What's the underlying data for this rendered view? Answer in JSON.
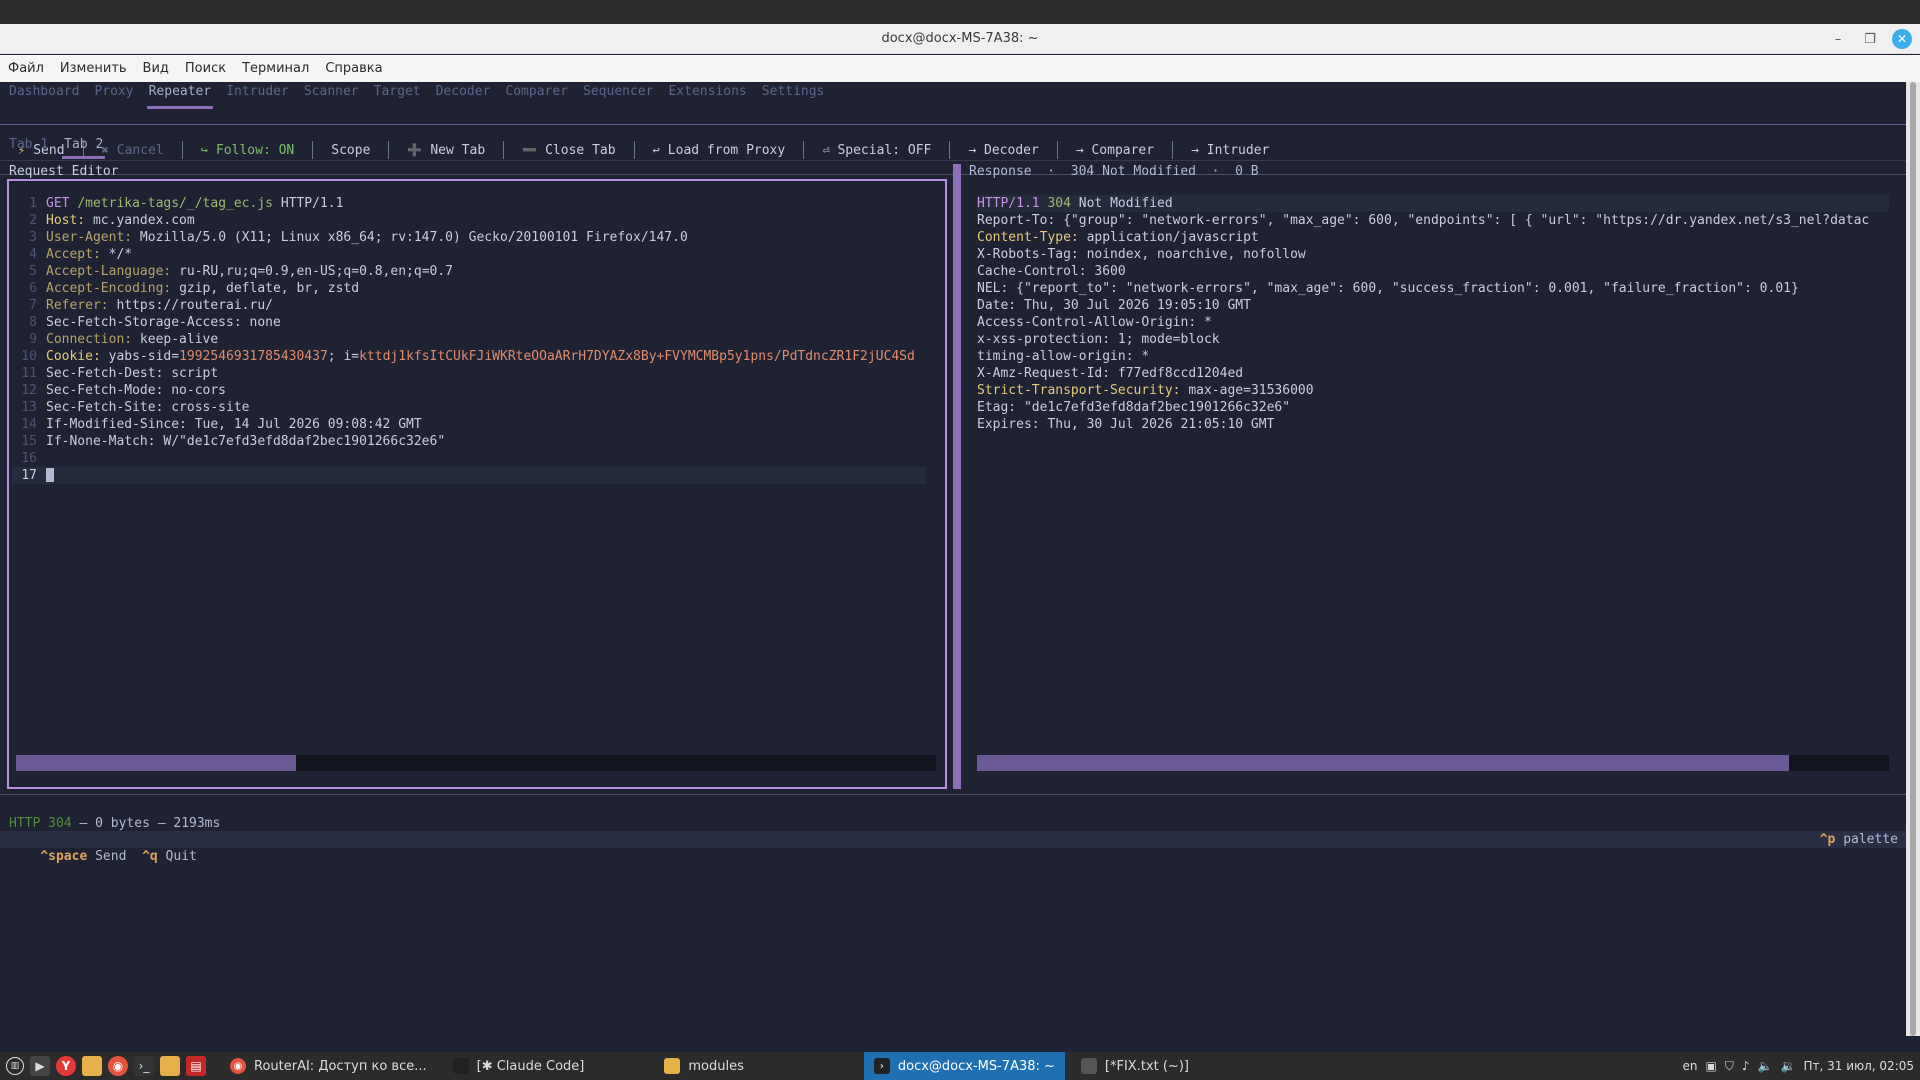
{
  "window": {
    "title": "docx@docx-MS-7A38: ~"
  },
  "menubar": [
    "Файл",
    "Изменить",
    "Вид",
    "Поиск",
    "Терминал",
    "Справка"
  ],
  "app_tabs": [
    "Dashboard",
    "Proxy",
    "Repeater",
    "Intruder",
    "Scanner",
    "Target",
    "Decoder",
    "Comparer",
    "Sequencer",
    "Extensions",
    "Settings"
  ],
  "active_app_tab": "Repeater",
  "toolbar": {
    "send": "Send",
    "cancel": "Cancel",
    "follow": "Follow: ON",
    "scope": "Scope",
    "new_tab": "New Tab",
    "close_tab": "Close Tab",
    "load_from_proxy": "Load from Proxy",
    "special": "Special: OFF",
    "decoder": "→ Decoder",
    "comparer": "→ Comparer",
    "intruder": "→ Intruder"
  },
  "request_tabs": [
    "Tab 1",
    "Tab 2"
  ],
  "request_editor": {
    "title": "Request Editor",
    "lines": {
      "l1_method": "GET",
      "l1_path": "/metrika-tags/_/tag_ec.js",
      "l1_ver": "HTTP/1.1",
      "l2_k": "Host:",
      "l2_v": "mc.yandex.com",
      "l3_k": "User-Agent:",
      "l3_v": "Mozilla/5.0 (X11; Linux x86_64; rv:147.0) Gecko/20100101 Firefox/147.0",
      "l4_k": "Accept:",
      "l4_v": "*/*",
      "l5_k": "Accept-Language:",
      "l5_v": "ru-RU,ru;q=0.9,en-US;q=0.8,en;q=0.7",
      "l6_k": "Accept-Encoding:",
      "l6_v": "gzip, deflate, br, zstd",
      "l7_k": "Referer:",
      "l7_v": "https://routerai.ru/",
      "l8": "Sec-Fetch-Storage-Access: none",
      "l9_k": "Connection:",
      "l9_v": "keep-alive",
      "l10_k": "Cookie:",
      "l10_a": "yabs-sid=",
      "l10_b": "1992546931785430437",
      "l10_c": "; i=",
      "l10_d": "kttdj1kfsItCUkFJiWKRteOOaARrH7DYAZx8By+FVYMCMBp5y1pns/PdTdncZR1F2jUC4Sd",
      "l11": "Sec-Fetch-Dest: script",
      "l12": "Sec-Fetch-Mode: no-cors",
      "l13": "Sec-Fetch-Site: cross-site",
      "l14": "If-Modified-Since: Tue, 14 Jul 2026 09:08:42 GMT",
      "l15": "If-None-Match: W/\"de1c7efd3efd8daf2bec1901266c32e6\"",
      "l16": "",
      "l17": ""
    },
    "line_numbers": [
      "1",
      "2",
      "3",
      "4",
      "5",
      "6",
      "7",
      "8",
      "9",
      "10",
      "11",
      "12",
      "13",
      "14",
      "15",
      "16",
      "17"
    ]
  },
  "response": {
    "header_label": "Response",
    "header_status": "304 Not Modified",
    "header_size": "0 B",
    "sep": "·",
    "status_ver": "HTTP/1.1",
    "status_code": "304",
    "status_text": "Not Modified",
    "lines": [
      "Report-To: {\"group\": \"network-errors\", \"max_age\": 600, \"endpoints\": [ { \"url\": \"https://dr.yandex.net/s3_nel?datac",
      "Content-Type:",
      " application/javascript",
      "X-Robots-Tag: noindex, noarchive, nofollow",
      "Cache-Control: 3600",
      "NEL: {\"report_to\": \"network-errors\", \"max_age\": 600, \"success_fraction\": 0.001, \"failure_fraction\": 0.01}",
      "Date: Thu, 30 Jul 2026 19:05:10 GMT",
      "Access-Control-Allow-Origin: *",
      "x-xss-protection: 1; mode=block",
      "timing-allow-origin: *",
      "X-Amz-Request-Id: f77edf8ccd1204ed",
      "Strict-Transport-Security:",
      " max-age=31536000",
      "Etag: \"de1c7efd3efd8daf2bec1901266c32e6\"",
      "Expires: Thu, 30 Jul 2026 21:05:10 GMT"
    ]
  },
  "status_bar": {
    "http": "HTTP 304",
    "rest": " — 0 bytes — 2193ms"
  },
  "keybar": {
    "k1": "^space",
    "v1": " Send",
    "k2": "^q",
    "v2": " Quit",
    "k3": "^p",
    "v3": " palette"
  },
  "taskbar": {
    "tasks": [
      "RouterAI: Доступ ко все...",
      "[✱ Claude Code]",
      "modules",
      "docx@docx-MS-7A38: ~",
      "[*FIX.txt (~)]"
    ],
    "lang": "en",
    "clock": "Пт, 31 июл, 02:05"
  }
}
